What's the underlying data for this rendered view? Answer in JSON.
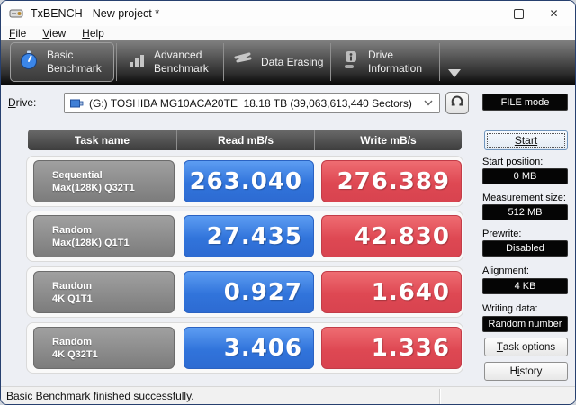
{
  "window": {
    "title": "TxBENCH - New project *",
    "close_glyph": "✕"
  },
  "menu": {
    "items": [
      {
        "text": "File",
        "underline": "F"
      },
      {
        "text": "View",
        "underline": "V"
      },
      {
        "text": "Help",
        "underline": "H"
      }
    ]
  },
  "tabs": {
    "items": [
      {
        "icon": "stopwatch-icon",
        "lines": [
          "Basic",
          "Benchmark"
        ],
        "selected": true
      },
      {
        "icon": "bar-chart-icon",
        "lines": [
          "Advanced",
          "Benchmark"
        ],
        "selected": false
      },
      {
        "icon": "eraser-scribble-icon",
        "lines": [
          "Data Erasing"
        ],
        "selected": false
      },
      {
        "icon": "drive-info-icon",
        "lines": [
          "Drive",
          "Information"
        ],
        "selected": false
      }
    ]
  },
  "drive": {
    "label": {
      "text": "Drive:",
      "underline": "D"
    },
    "value": "(G:) TOSHIBA MG10ACA20TE  18.18 TB (39,063,613,440 Sectors)"
  },
  "file_mode_label": "FILE mode",
  "table": {
    "headers": [
      "Task name",
      "Read mB/s",
      "Write mB/s"
    ],
    "rows": [
      {
        "task_lines": [
          "Sequential",
          "Max(128K) Q32T1"
        ],
        "read": "263.040",
        "write": "276.389"
      },
      {
        "task_lines": [
          "Random",
          "Max(128K) Q1T1"
        ],
        "read": "27.435",
        "write": "42.830"
      },
      {
        "task_lines": [
          "Random",
          "4K Q1T1"
        ],
        "read": "0.927",
        "write": "1.640"
      },
      {
        "task_lines": [
          "Random",
          "4K Q32T1"
        ],
        "read": "3.406",
        "write": "1.336"
      }
    ]
  },
  "panel": {
    "start_button": {
      "text": "Start",
      "underline": "Start"
    },
    "fields": [
      {
        "label": "Start position:",
        "value": "0 MB"
      },
      {
        "label": "Measurement size:",
        "value": "512 MB"
      },
      {
        "label": "Prewrite:",
        "value": "Disabled"
      },
      {
        "label": "Alignment:",
        "value": "4 KB"
      },
      {
        "label": "Writing data:",
        "value": "Random number"
      }
    ],
    "buttons": [
      {
        "text": "Task options",
        "underline": "T"
      },
      {
        "text": "History",
        "underline": "i"
      }
    ]
  },
  "statusbar": {
    "message": "Basic Benchmark finished successfully."
  },
  "colors": {
    "read_box": "#3174db",
    "write_box": "#de4853",
    "tab_strip_dark": "#050505",
    "panel_value_bg": "#050505",
    "window_border": "#27406f",
    "stopwatch_blue": "#3b86e8"
  }
}
